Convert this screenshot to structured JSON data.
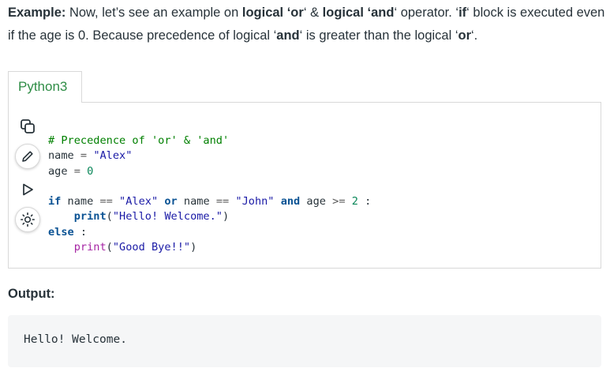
{
  "intro": {
    "example_label": "Example:",
    "t1": " Now, let’s see an example on ",
    "b1": "logical ‘or",
    "t2": "‘ & ",
    "b2": "logical ‘and",
    "t3": "‘  operator.  ‘",
    "b3": "if",
    "t4": "‘ block is executed even if the age is 0. Because precedence of logical ‘",
    "b4": "and",
    "t5": "‘ is greater than the logical ‘",
    "b5": "or",
    "t6": "‘."
  },
  "editor": {
    "tab_label": "Python3",
    "tools": [
      "copy-icon",
      "pencil-icon",
      "play-icon",
      "sun-icon"
    ],
    "code": {
      "l1": "# Precedence of 'or' & 'and'",
      "l2_var": "name",
      "l2_eq": " = ",
      "l2_val": "\"Alex\"",
      "l3_var": "age",
      "l3_eq": " = ",
      "l3_val": "0",
      "l5_if": "if",
      "l5_a": " name ",
      "l5_op1": "==",
      "l5_s1": " \"Alex\" ",
      "l5_or": "or",
      "l5_b": " name ",
      "l5_op2": "==",
      "l5_s2": " \"John\" ",
      "l5_and": "and",
      "l5_c": " age ",
      "l5_op3": ">=",
      "l5_num": " 2",
      "l5_colon": " :",
      "l6_fn": "print",
      "l6_open": "(",
      "l6_str": "\"Hello! Welcome.\"",
      "l6_close": ")",
      "l7_else": "else",
      "l7_colon": " :",
      "l8_fn": "print",
      "l8_open": "(",
      "l8_str": "\"Good Bye!!\"",
      "l8_close": ")"
    }
  },
  "output": {
    "title": "Output:",
    "text": "Hello! Welcome."
  },
  "colors": {
    "accent_green": "#2f8d46",
    "comment": "#008000",
    "string": "#1a1aa6",
    "keyword": "#0b5394",
    "function": "#a626a4"
  }
}
